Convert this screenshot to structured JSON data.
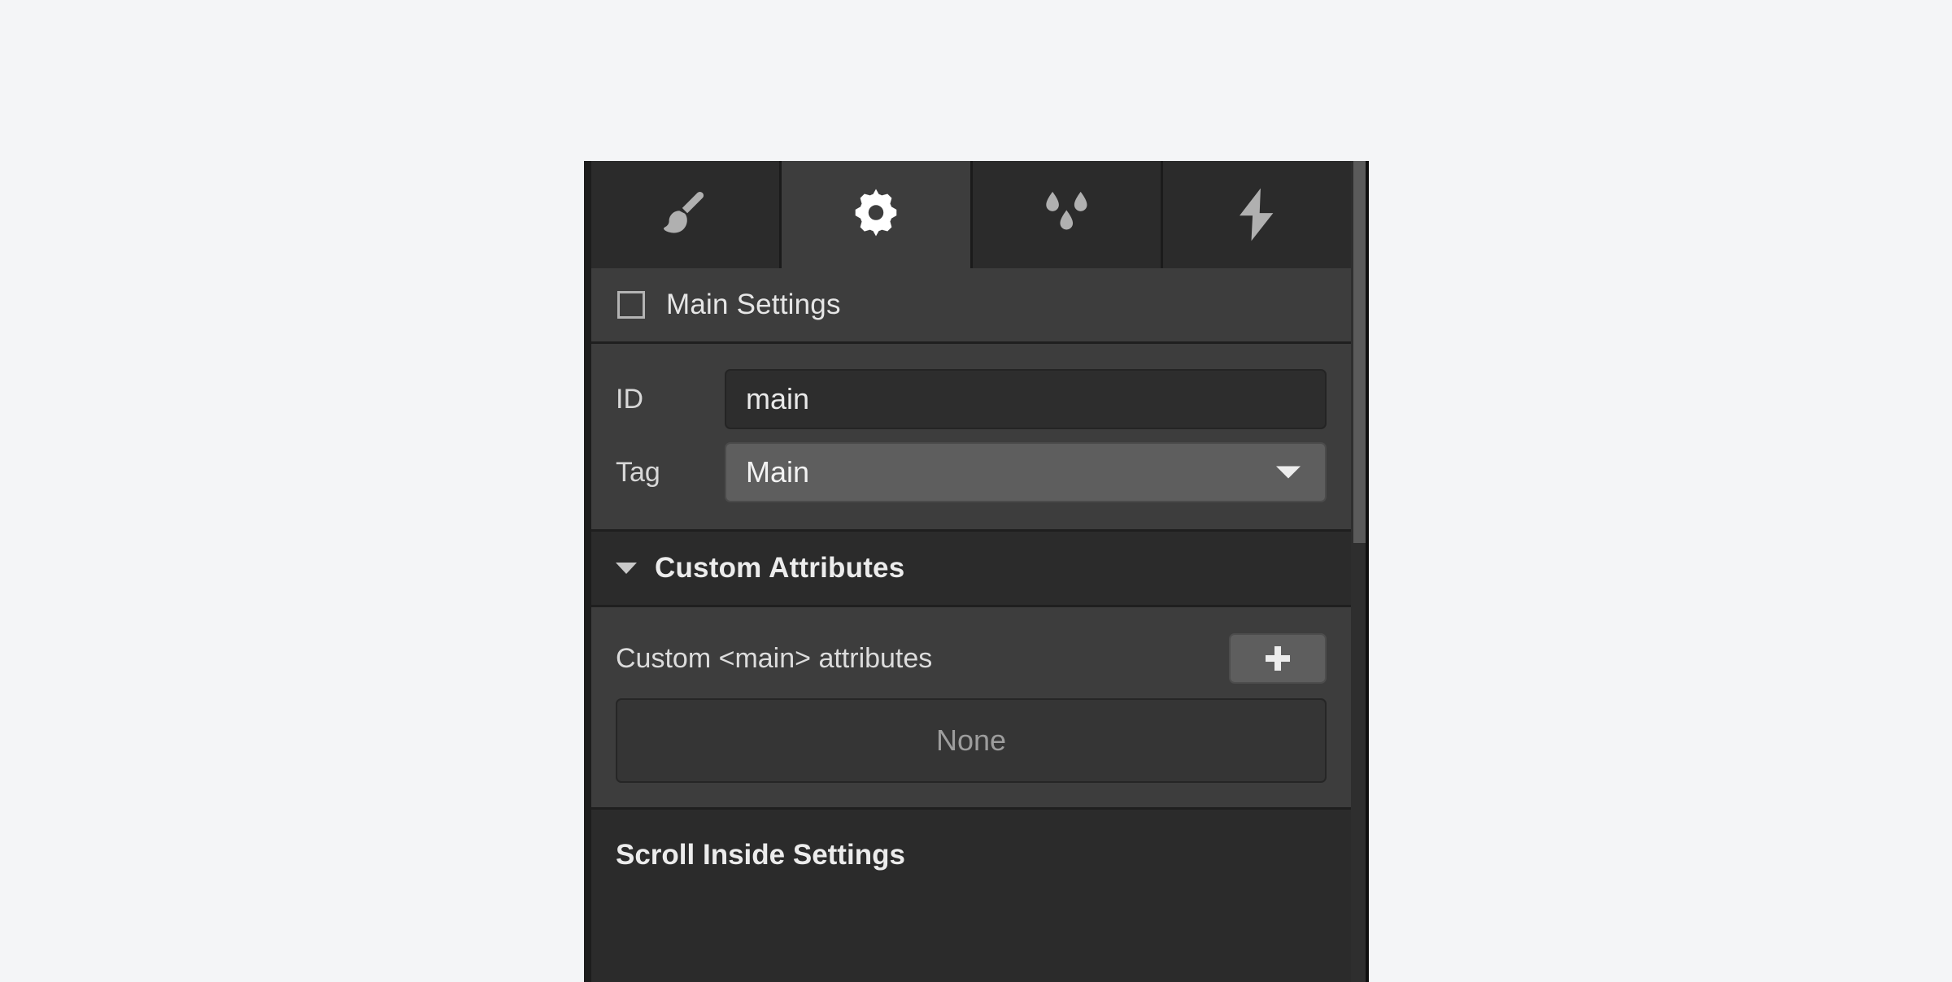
{
  "panel": {
    "background_color": "#3d3d3d",
    "page_background_color": "#f4f5f7"
  },
  "tabs": [
    {
      "icon": "paintbrush-icon",
      "name": "style-tab",
      "active": false
    },
    {
      "icon": "gear-icon",
      "name": "settings-tab",
      "active": true
    },
    {
      "icon": "droplets-icon",
      "name": "effects-tab",
      "active": false
    },
    {
      "icon": "lightning-bolt-icon",
      "name": "interactions-tab",
      "active": false
    }
  ],
  "main_settings": {
    "header_label": "Main Settings",
    "header_icon": "square-icon",
    "fields": [
      {
        "label": "ID",
        "type": "text",
        "value": "main",
        "name": "id-field"
      },
      {
        "label": "Tag",
        "type": "select",
        "value": "Main",
        "name": "tag-select"
      }
    ]
  },
  "custom_attributes": {
    "title": "Custom Attributes",
    "collapse_icon": "caret-down-icon",
    "expanded": true,
    "row_label": "Custom <main> attributes",
    "add_button_icon": "plus-icon",
    "empty_text": "None"
  },
  "bottom_section": {
    "title": "Scroll Inside Settings"
  }
}
